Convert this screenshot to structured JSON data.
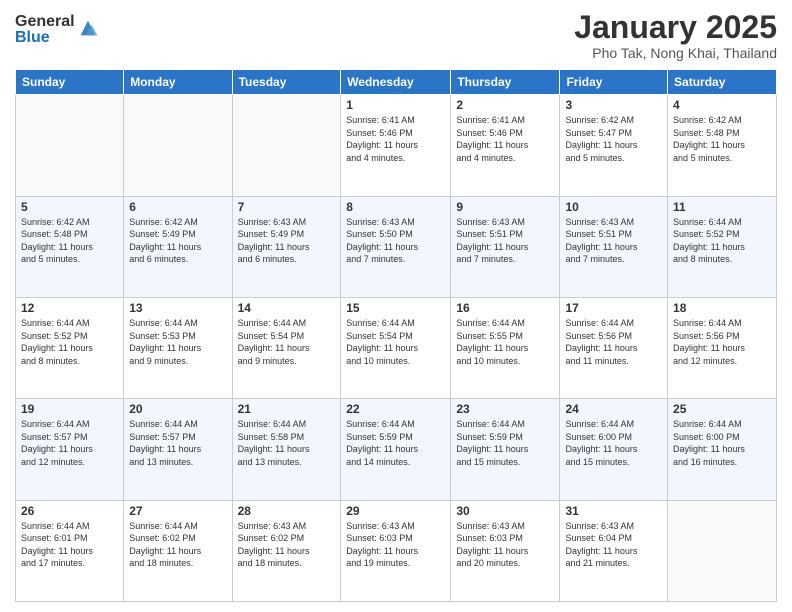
{
  "header": {
    "logo": {
      "general": "General",
      "blue": "Blue"
    },
    "title": "January 2025",
    "subtitle": "Pho Tak, Nong Khai, Thailand"
  },
  "weekdays": [
    "Sunday",
    "Monday",
    "Tuesday",
    "Wednesday",
    "Thursday",
    "Friday",
    "Saturday"
  ],
  "weeks": [
    [
      {
        "day": "",
        "info": ""
      },
      {
        "day": "",
        "info": ""
      },
      {
        "day": "",
        "info": ""
      },
      {
        "day": "1",
        "info": "Sunrise: 6:41 AM\nSunset: 5:46 PM\nDaylight: 11 hours\nand 4 minutes."
      },
      {
        "day": "2",
        "info": "Sunrise: 6:41 AM\nSunset: 5:46 PM\nDaylight: 11 hours\nand 4 minutes."
      },
      {
        "day": "3",
        "info": "Sunrise: 6:42 AM\nSunset: 5:47 PM\nDaylight: 11 hours\nand 5 minutes."
      },
      {
        "day": "4",
        "info": "Sunrise: 6:42 AM\nSunset: 5:48 PM\nDaylight: 11 hours\nand 5 minutes."
      }
    ],
    [
      {
        "day": "5",
        "info": "Sunrise: 6:42 AM\nSunset: 5:48 PM\nDaylight: 11 hours\nand 5 minutes."
      },
      {
        "day": "6",
        "info": "Sunrise: 6:42 AM\nSunset: 5:49 PM\nDaylight: 11 hours\nand 6 minutes."
      },
      {
        "day": "7",
        "info": "Sunrise: 6:43 AM\nSunset: 5:49 PM\nDaylight: 11 hours\nand 6 minutes."
      },
      {
        "day": "8",
        "info": "Sunrise: 6:43 AM\nSunset: 5:50 PM\nDaylight: 11 hours\nand 7 minutes."
      },
      {
        "day": "9",
        "info": "Sunrise: 6:43 AM\nSunset: 5:51 PM\nDaylight: 11 hours\nand 7 minutes."
      },
      {
        "day": "10",
        "info": "Sunrise: 6:43 AM\nSunset: 5:51 PM\nDaylight: 11 hours\nand 7 minutes."
      },
      {
        "day": "11",
        "info": "Sunrise: 6:44 AM\nSunset: 5:52 PM\nDaylight: 11 hours\nand 8 minutes."
      }
    ],
    [
      {
        "day": "12",
        "info": "Sunrise: 6:44 AM\nSunset: 5:52 PM\nDaylight: 11 hours\nand 8 minutes."
      },
      {
        "day": "13",
        "info": "Sunrise: 6:44 AM\nSunset: 5:53 PM\nDaylight: 11 hours\nand 9 minutes."
      },
      {
        "day": "14",
        "info": "Sunrise: 6:44 AM\nSunset: 5:54 PM\nDaylight: 11 hours\nand 9 minutes."
      },
      {
        "day": "15",
        "info": "Sunrise: 6:44 AM\nSunset: 5:54 PM\nDaylight: 11 hours\nand 10 minutes."
      },
      {
        "day": "16",
        "info": "Sunrise: 6:44 AM\nSunset: 5:55 PM\nDaylight: 11 hours\nand 10 minutes."
      },
      {
        "day": "17",
        "info": "Sunrise: 6:44 AM\nSunset: 5:56 PM\nDaylight: 11 hours\nand 11 minutes."
      },
      {
        "day": "18",
        "info": "Sunrise: 6:44 AM\nSunset: 5:56 PM\nDaylight: 11 hours\nand 12 minutes."
      }
    ],
    [
      {
        "day": "19",
        "info": "Sunrise: 6:44 AM\nSunset: 5:57 PM\nDaylight: 11 hours\nand 12 minutes."
      },
      {
        "day": "20",
        "info": "Sunrise: 6:44 AM\nSunset: 5:57 PM\nDaylight: 11 hours\nand 13 minutes."
      },
      {
        "day": "21",
        "info": "Sunrise: 6:44 AM\nSunset: 5:58 PM\nDaylight: 11 hours\nand 13 minutes."
      },
      {
        "day": "22",
        "info": "Sunrise: 6:44 AM\nSunset: 5:59 PM\nDaylight: 11 hours\nand 14 minutes."
      },
      {
        "day": "23",
        "info": "Sunrise: 6:44 AM\nSunset: 5:59 PM\nDaylight: 11 hours\nand 15 minutes."
      },
      {
        "day": "24",
        "info": "Sunrise: 6:44 AM\nSunset: 6:00 PM\nDaylight: 11 hours\nand 15 minutes."
      },
      {
        "day": "25",
        "info": "Sunrise: 6:44 AM\nSunset: 6:00 PM\nDaylight: 11 hours\nand 16 minutes."
      }
    ],
    [
      {
        "day": "26",
        "info": "Sunrise: 6:44 AM\nSunset: 6:01 PM\nDaylight: 11 hours\nand 17 minutes."
      },
      {
        "day": "27",
        "info": "Sunrise: 6:44 AM\nSunset: 6:02 PM\nDaylight: 11 hours\nand 18 minutes."
      },
      {
        "day": "28",
        "info": "Sunrise: 6:43 AM\nSunset: 6:02 PM\nDaylight: 11 hours\nand 18 minutes."
      },
      {
        "day": "29",
        "info": "Sunrise: 6:43 AM\nSunset: 6:03 PM\nDaylight: 11 hours\nand 19 minutes."
      },
      {
        "day": "30",
        "info": "Sunrise: 6:43 AM\nSunset: 6:03 PM\nDaylight: 11 hours\nand 20 minutes."
      },
      {
        "day": "31",
        "info": "Sunrise: 6:43 AM\nSunset: 6:04 PM\nDaylight: 11 hours\nand 21 minutes."
      },
      {
        "day": "",
        "info": ""
      }
    ]
  ]
}
